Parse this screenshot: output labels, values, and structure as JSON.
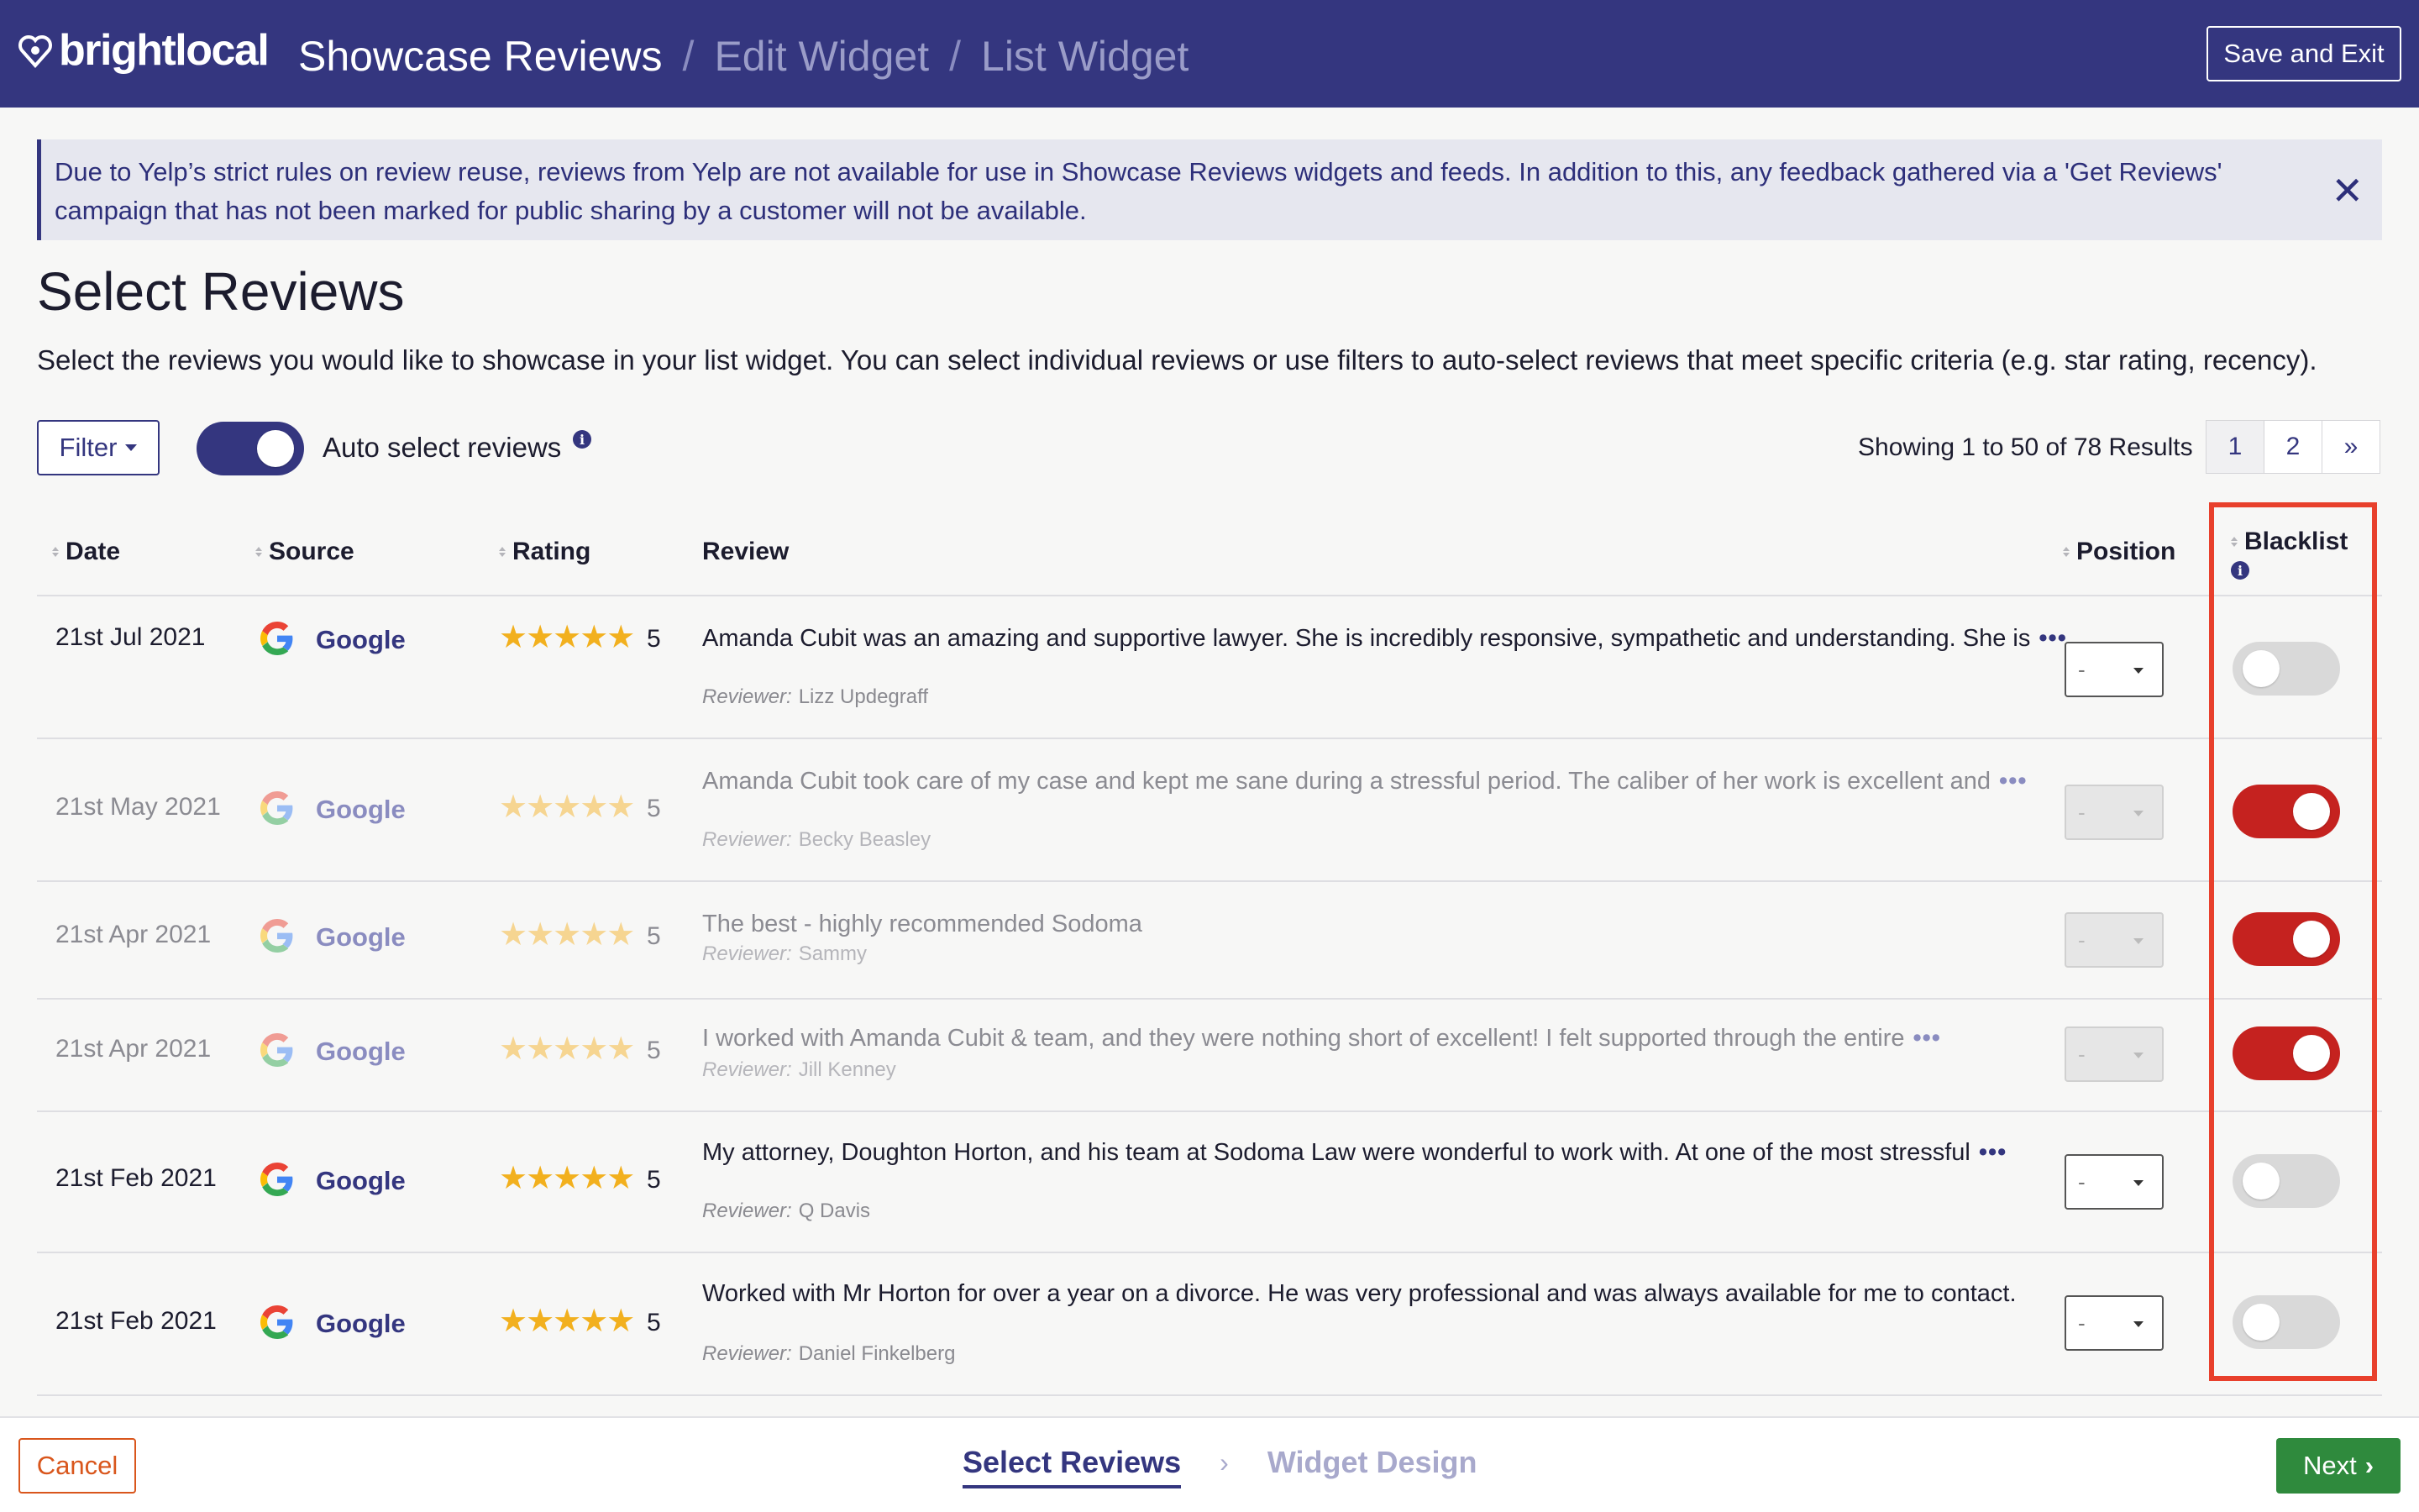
{
  "header": {
    "logo_text": "brightlocal",
    "breadcrumb": [
      "Showcase Reviews",
      "Edit Widget",
      "List Widget"
    ],
    "save_exit_label": "Save and Exit",
    "bg_color": "#34367f"
  },
  "alert": {
    "text": "Due to Yelp’s strict rules on review reuse, reviews from Yelp are not available for use in Showcase Reviews widgets and feeds. In addition to this, any feedback gathered via a 'Get Reviews' campaign that has not been marked for public sharing by a customer will not be available.",
    "close_icon": "close-icon"
  },
  "page": {
    "title": "Select Reviews",
    "description": "Select the reviews you would like to showcase in your list widget. You can select individual reviews or use filters to auto-select reviews that meet specific criteria (e.g. star rating, recency)."
  },
  "controls": {
    "filter_label": "Filter",
    "auto_select_label": "Auto select reviews",
    "auto_select_on": true,
    "showing_text": "Showing 1 to 50 of 78 Results",
    "pages": [
      "1",
      "2",
      "»"
    ],
    "current_page": "1"
  },
  "table": {
    "headers": {
      "date": "Date",
      "source": "Source",
      "rating": "Rating",
      "review": "Review",
      "position": "Position",
      "blacklist": "Blacklist"
    },
    "reviewer_label": "Reviewer:",
    "rows": [
      {
        "date": "21st Jul 2021",
        "source": "Google",
        "rating": "5",
        "stars": "★★★★★",
        "review": "Amanda Cubit was an amazing and supportive lawyer. She is incredibly responsive, sympathetic and understanding. She is",
        "more": "•••",
        "reviewer": "Lizz Updegraff",
        "position": "-",
        "blacklisted": false
      },
      {
        "date": "21st May 2021",
        "source": "Google",
        "rating": "5",
        "stars": "★★★★★",
        "review": "Amanda Cubit took care of my case and kept me sane during a stressful period. The caliber of her work is excellent and",
        "more": "•••",
        "reviewer": "Becky Beasley",
        "position": "-",
        "blacklisted": true
      },
      {
        "date": "21st Apr 2021",
        "source": "Google",
        "rating": "5",
        "stars": "★★★★★",
        "review": "The best - highly recommended Sodoma",
        "more": "",
        "reviewer": "Sammy",
        "position": "-",
        "blacklisted": true
      },
      {
        "date": "21st Apr 2021",
        "source": "Google",
        "rating": "5",
        "stars": "★★★★★",
        "review": "I worked with Amanda Cubit & team, and they were nothing short of excellent! I felt supported through the entire",
        "more": "•••",
        "reviewer": "Jill Kenney",
        "position": "-",
        "blacklisted": true
      },
      {
        "date": "21st Feb 2021",
        "source": "Google",
        "rating": "5",
        "stars": "★★★★★",
        "review": "My attorney, Doughton Horton, and his team at Sodoma Law were wonderful to work with. At one of the most stressful",
        "more": "•••",
        "reviewer": "Q Davis",
        "position": "-",
        "blacklisted": false
      },
      {
        "date": "21st Feb 2021",
        "source": "Google",
        "rating": "5",
        "stars": "★★★★★",
        "review": "Worked with Mr Horton for over a year on a divorce. He was very professional and was always available for me to contact.",
        "more": "",
        "reviewer": "Daniel Finkelberg",
        "position": "-",
        "blacklisted": false
      }
    ]
  },
  "footer": {
    "cancel_label": "Cancel",
    "steps": [
      "Select Reviews",
      "Widget Design"
    ],
    "step_separator": "›",
    "next_label": "Next"
  },
  "colors": {
    "brand": "#34367f",
    "star": "#f2b01e",
    "blacklist_on": "#c5221f",
    "next": "#2f8a3d",
    "cancel": "#d9561c",
    "highlight": "#e8402c"
  }
}
